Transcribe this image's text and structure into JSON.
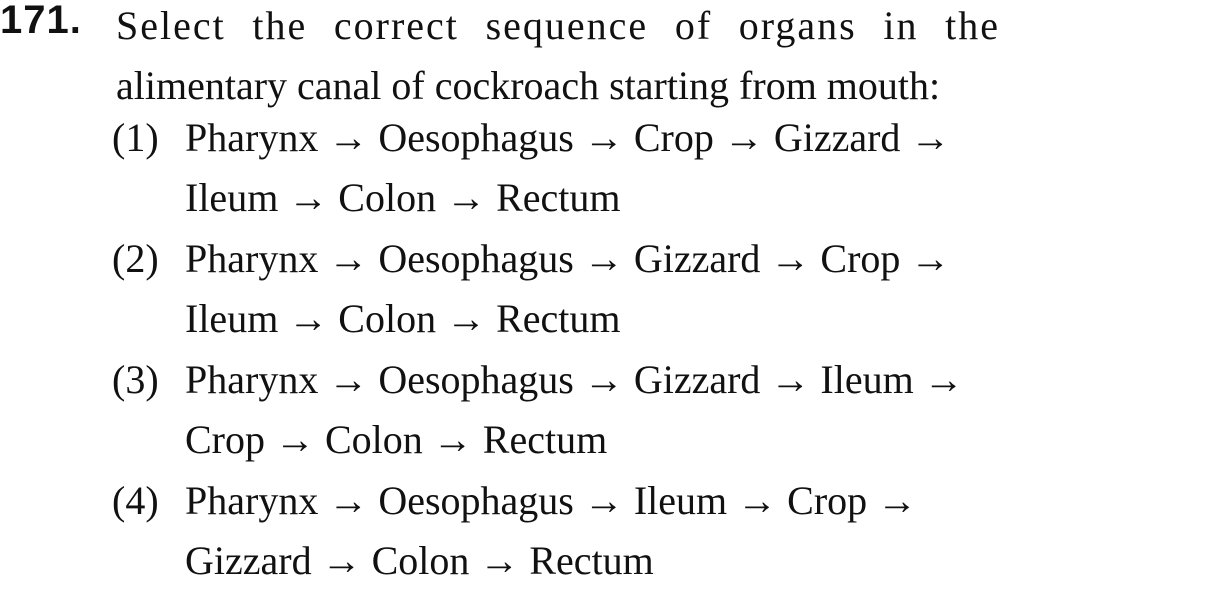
{
  "question": {
    "number": "171.",
    "stem_line1": "Select the correct sequence of organs in the",
    "stem_line2": "alimentary canal of cockroach starting from mouth:",
    "options": [
      {
        "label": "(1)",
        "line1": "Pharynx → Oesophagus → Crop → Gizzard →",
        "line2": "Ileum → Colon → Rectum"
      },
      {
        "label": "(2)",
        "line1": "Pharynx → Oesophagus → Gizzard → Crop →",
        "line2": "Ileum → Colon → Rectum"
      },
      {
        "label": "(3)",
        "line1": "Pharynx → Oesophagus → Gizzard → Ileum →",
        "line2": "Crop → Colon → Rectum"
      },
      {
        "label": "(4)",
        "line1": "Pharynx → Oesophagus → Ileum → Crop →",
        "line2": "Gizzard → Colon → Rectum"
      }
    ]
  }
}
